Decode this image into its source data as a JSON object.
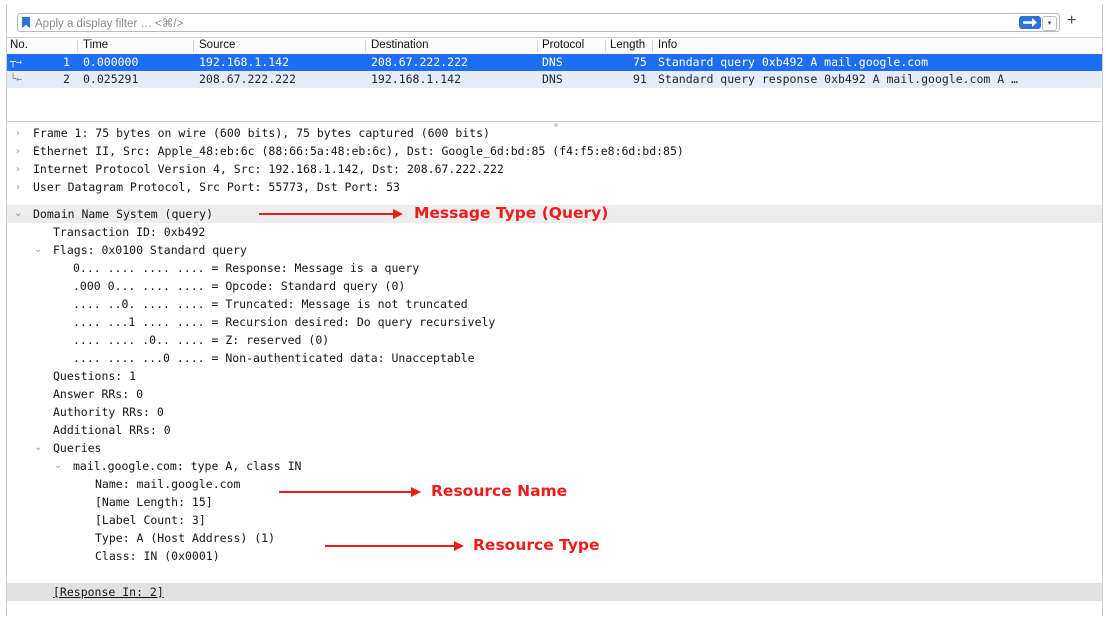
{
  "filter": {
    "placeholder": "Apply a display filter … <⌘/>",
    "add_label": "+",
    "dropdown_label": "▾"
  },
  "columns": [
    "No.",
    "Time",
    "Source",
    "Destination",
    "Protocol",
    "Length",
    "Info"
  ],
  "packets": [
    {
      "no": "1",
      "time": "0.000000",
      "source": "192.168.1.142",
      "destination": "208.67.222.222",
      "protocol": "DNS",
      "length": "75",
      "info": "Standard query 0xb492 A mail.google.com"
    },
    {
      "no": "2",
      "time": "0.025291",
      "source": "208.67.222.222",
      "destination": "192.168.1.142",
      "protocol": "DNS",
      "length": "91",
      "info": "Standard query response 0xb492 A mail.google.com A …"
    }
  ],
  "details": {
    "frame": "Frame 1: 75 bytes on wire (600 bits), 75 bytes captured (600 bits)",
    "ethernet": "Ethernet II, Src: Apple_48:eb:6c (88:66:5a:48:eb:6c), Dst: Google_6d:bd:85 (f4:f5:e8:6d:bd:85)",
    "ip": "Internet Protocol Version 4, Src: 192.168.1.142, Dst: 208.67.222.222",
    "udp": "User Datagram Protocol, Src Port: 55773, Dst Port: 53",
    "dns": "Domain Name System (query)",
    "transaction_id": "Transaction ID: 0xb492",
    "flags": "Flags: 0x0100 Standard query",
    "flag_lines": [
      "0... .... .... .... = Response: Message is a query",
      ".000 0... .... .... = Opcode: Standard query (0)",
      ".... ..0. .... .... = Truncated: Message is not truncated",
      ".... ...1 .... .... = Recursion desired: Do query recursively",
      ".... .... .0.. .... = Z: reserved (0)",
      ".... .... ...0 .... = Non-authenticated data: Unacceptable"
    ],
    "questions": "Questions: 1",
    "answer_rrs": "Answer RRs: 0",
    "authority_rrs": "Authority RRs: 0",
    "additional_rrs": "Additional RRs: 0",
    "queries": "Queries",
    "query_entry": "mail.google.com: type A, class IN",
    "name": "Name: mail.google.com",
    "name_length": "[Name Length: 15]",
    "label_count": "[Label Count: 3]",
    "type": "Type: A (Host Address) (1)",
    "class": "Class: IN (0x0001)",
    "response_in": "[Response In: 2]"
  },
  "annotations": {
    "message_type": "Message Type (Query)",
    "resource_name": "Resource Name",
    "resource_type": "Resource Type",
    "color": "#ee1c1c"
  },
  "colors": {
    "selected_row": "#1d6ef2",
    "alt_row": "#e4ecf7",
    "accent": "#2a74d6"
  }
}
